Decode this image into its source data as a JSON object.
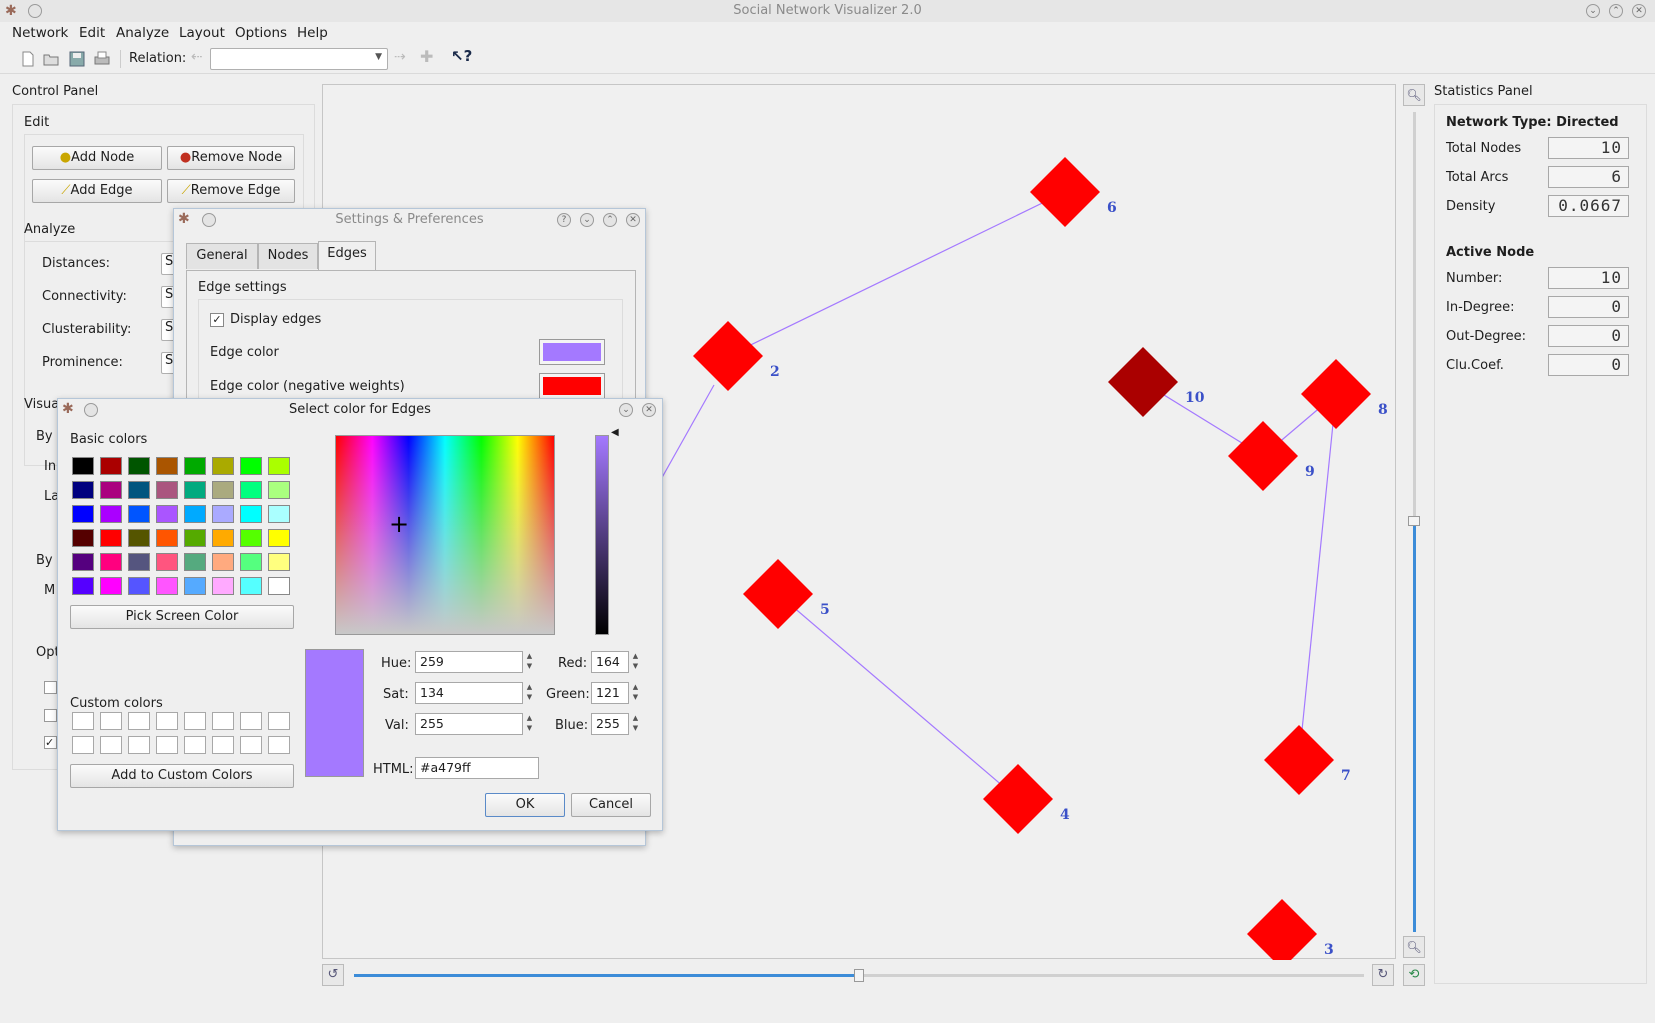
{
  "app": {
    "title": "Social Network Visualizer 2.0"
  },
  "menu": [
    "Network",
    "Edit",
    "Analyze",
    "Layout",
    "Options",
    "Help"
  ],
  "toolbar": {
    "relation_label": "Relation:",
    "relation_value": ""
  },
  "control_panel": {
    "title": "Control Panel",
    "edit_title": "Edit",
    "add_node": "Add Node",
    "remove_node": "Remove Node",
    "add_edge": "Add Edge",
    "remove_edge": "Remove Edge",
    "analyze_title": "Analyze",
    "distances": "Distances:",
    "connectivity": "Connectivity:",
    "clusterability": "Clusterability:",
    "prominence": "Prominence:",
    "combo_s": "S",
    "visualize_partial": "Visua",
    "by_partial_1": "By I",
    "in_partial": "In",
    "la_partial": "La",
    "by_partial_2": "By I",
    "m_partial": "M",
    "opt_partial": "Opt"
  },
  "statistics": {
    "title": "Statistics Panel",
    "network_type": "Network Type: Directed",
    "total_nodes_label": "Total Nodes",
    "total_nodes": "10",
    "total_arcs_label": "Total Arcs",
    "total_arcs": "6",
    "density_label": "Density",
    "density": "0.0667",
    "active_node": "Active Node",
    "number_label": "Number:",
    "number": "10",
    "in_degree_label": "In-Degree:",
    "in_degree": "0",
    "out_degree_label": "Out-Degree:",
    "out_degree": "0",
    "clucoef_label": "Clu.Coef.",
    "clucoef": "0"
  },
  "graph": {
    "nodes": [
      {
        "id": "2",
        "color": "#ff0000"
      },
      {
        "id": "3",
        "color": "#ff0000"
      },
      {
        "id": "4",
        "color": "#ff0000"
      },
      {
        "id": "5",
        "color": "#ff0000"
      },
      {
        "id": "6",
        "color": "#ff0000"
      },
      {
        "id": "7",
        "color": "#ff0000"
      },
      {
        "id": "8",
        "color": "#ff0000"
      },
      {
        "id": "9",
        "color": "#ff0000"
      },
      {
        "id": "10",
        "color": "#aa0000"
      }
    ],
    "edges": [
      [
        "2",
        "6"
      ],
      [
        "5",
        "4"
      ],
      [
        "10",
        "9"
      ],
      [
        "9",
        "8"
      ],
      [
        "8",
        "7"
      ]
    ],
    "edge_color": "#a479ff",
    "label_color": "#3a50c8"
  },
  "settings_dialog": {
    "title": "Settings & Preferences",
    "tabs": [
      "General",
      "Nodes",
      "Edges"
    ],
    "active_tab": "Edges",
    "group": "Edge settings",
    "display_edges": "Display edges",
    "display_edges_checked": true,
    "edge_color_label": "Edge color",
    "edge_color": "#a479ff",
    "edge_color_neg_label": "Edge color (negative weights)",
    "edge_color_neg": "#ff0000"
  },
  "color_dialog": {
    "title": "Select color for Edges",
    "basic_colors_label": "Basic colors",
    "basic_colors": [
      "#000000",
      "#aa0000",
      "#005500",
      "#aa5500",
      "#00aa00",
      "#aaaa00",
      "#00ff00",
      "#aaff00",
      "#00007f",
      "#aa007f",
      "#00557f",
      "#aa557f",
      "#00aa7f",
      "#aaaa7f",
      "#00ff7f",
      "#aaff7f",
      "#0000ff",
      "#aa00ff",
      "#0055ff",
      "#aa55ff",
      "#00aaff",
      "#aaaaff",
      "#00ffff",
      "#aaffff",
      "#550000",
      "#ff0000",
      "#555500",
      "#ff5500",
      "#55aa00",
      "#ffaa00",
      "#55ff00",
      "#ffff00",
      "#55007f",
      "#ff007f",
      "#55557f",
      "#ff557f",
      "#55aa7f",
      "#ffaa7f",
      "#55ff7f",
      "#ffff7f",
      "#5500ff",
      "#ff00ff",
      "#5555ff",
      "#ff55ff",
      "#55aaff",
      "#ffaaff",
      "#55ffff",
      "#ffffff"
    ],
    "pick_screen": "Pick Screen Color",
    "custom_colors_label": "Custom colors",
    "add_custom": "Add to Custom Colors",
    "hue_label": "Hue:",
    "hue": "259",
    "sat_label": "Sat:",
    "sat": "134",
    "val_label": "Val:",
    "val": "255",
    "red_label": "Red:",
    "red": "164",
    "green_label": "Green:",
    "green": "121",
    "blue_label": "Blue:",
    "blue": "255",
    "html_label": "HTML:",
    "html": "#a479ff",
    "ok": "OK",
    "cancel": "Cancel",
    "current_color": "#a479ff"
  }
}
